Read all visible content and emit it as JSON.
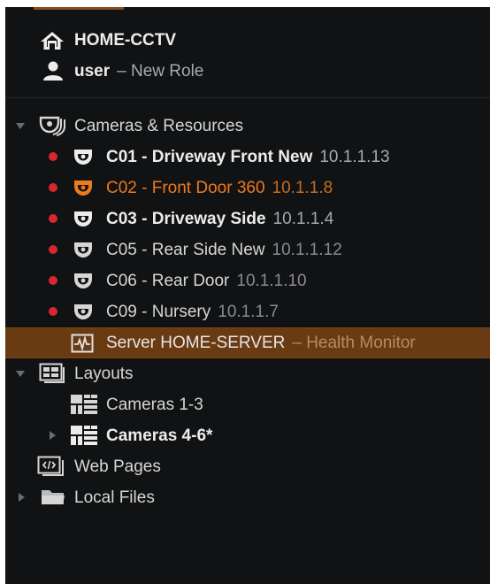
{
  "colors": {
    "panel_bg": "#111213",
    "selection_bg": "#6a3a12",
    "accent_orange": "#ef7a1a",
    "status_red": "#d8262c",
    "text": "#d6d6d6"
  },
  "header": {
    "system_name": "HOME-CCTV",
    "system_icon": "home-icon",
    "user_name": "user",
    "user_role": "– New Role",
    "user_icon": "user-icon"
  },
  "tree": {
    "cameras_group": {
      "label": "Cameras & Resources",
      "icon": "cameras-resources-icon",
      "expanded": true,
      "cameras": [
        {
          "name": "C01 - Driveway Front New",
          "ip": "10.1.1.13",
          "status": "offline",
          "icon": "camera-icon",
          "bold": true
        },
        {
          "name": "C02 - Front Door 360",
          "ip": "10.1.1.8",
          "status": "offline",
          "icon": "camera-icon",
          "highlighted": true
        },
        {
          "name": "C03 - Driveway Side",
          "ip": "10.1.1.4",
          "status": "offline",
          "icon": "camera-icon",
          "bold": true
        },
        {
          "name": "C05 - Rear Side New",
          "ip": "10.1.1.12",
          "status": "offline",
          "icon": "camera-icon"
        },
        {
          "name": "C06 - Rear Door",
          "ip": "10.1.1.10",
          "status": "offline",
          "icon": "camera-icon"
        },
        {
          "name": "C09 - Nursery",
          "ip": "10.1.1.7",
          "status": "offline",
          "icon": "camera-icon"
        }
      ],
      "server": {
        "name": "Server HOME-SERVER",
        "suffix": "– Health Monitor",
        "icon": "health-monitor-icon",
        "selected": true
      }
    },
    "layouts_group": {
      "label": "Layouts",
      "icon": "layouts-icon",
      "expanded": true,
      "items": [
        {
          "label": "Cameras 1-3",
          "icon": "layout-grid-icon",
          "expandable": false
        },
        {
          "label": "Cameras 4-6*",
          "icon": "layout-grid-icon",
          "expandable": true,
          "bold": true
        }
      ]
    },
    "web_pages": {
      "label": "Web Pages",
      "icon": "web-pages-icon"
    },
    "local_files": {
      "label": "Local Files",
      "icon": "folder-icon",
      "expandable": true
    }
  }
}
